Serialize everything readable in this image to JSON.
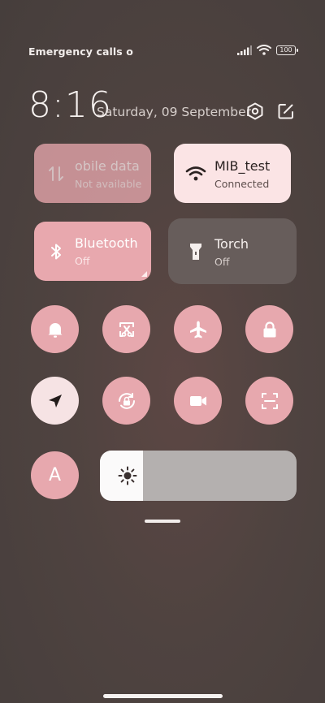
{
  "status_bar": {
    "left_text": "Emergency calls o",
    "battery": "100"
  },
  "header": {
    "time": "8:16",
    "date": "Saturday, 09 September"
  },
  "tiles": {
    "mobile_data": {
      "title": "obile data",
      "subtitle": "Not available"
    },
    "wifi": {
      "title": "MIB_test",
      "subtitle": "Connected"
    },
    "bluetooth": {
      "title": "Bluetooth",
      "subtitle": "Off"
    },
    "torch": {
      "title": "Torch",
      "subtitle": "Off"
    }
  },
  "toggles_row1": [
    {
      "icon": "bell-icon"
    },
    {
      "icon": "screenshot-icon"
    },
    {
      "icon": "airplane-icon"
    },
    {
      "icon": "lock-icon"
    }
  ],
  "toggles_row2": [
    {
      "icon": "location-icon",
      "active": true
    },
    {
      "icon": "rotation-lock-icon"
    },
    {
      "icon": "video-camera-icon"
    },
    {
      "icon": "scan-icon"
    }
  ],
  "auto_brightness_label": "A",
  "brightness": {
    "level": 0.22
  },
  "colors": {
    "accent_pink": "#e7a8ae",
    "active_tile": "#fbe4e5",
    "inactive_tile": "#675d5b"
  }
}
